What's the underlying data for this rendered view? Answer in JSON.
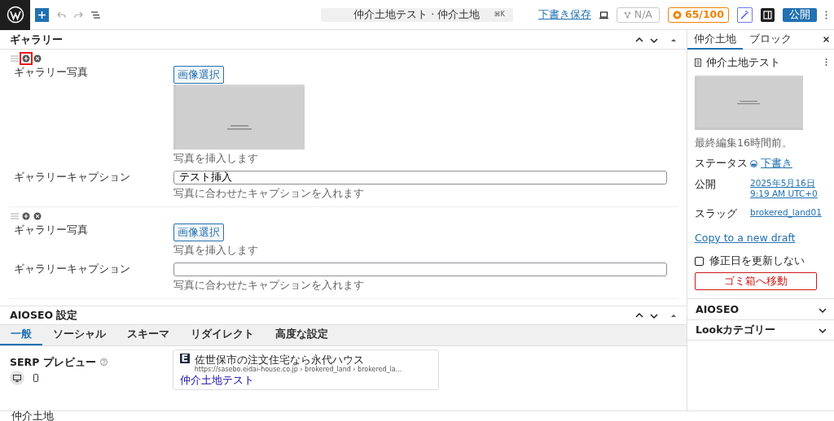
{
  "topbar": {
    "search": "仲介土地テスト · 仲介土地",
    "shortcut": "⌘K",
    "save_draft": "下書き保存",
    "seo_na": "N/A",
    "seo_score": "65/100",
    "publish": "公開"
  },
  "gallery": {
    "title": "ギャラリー",
    "items": [
      {
        "highlighted": true,
        "photo_label": "ギャラリー写真",
        "select_button": "画像選択",
        "has_image": true,
        "photo_help": "写真を挿入します",
        "caption_label": "ギャラリーキャプション",
        "caption_value": "テスト挿入",
        "caption_help": "写真に合わせたキャプションを入れます"
      },
      {
        "highlighted": false,
        "photo_label": "ギャラリー写真",
        "select_button": "画像選択",
        "has_image": false,
        "photo_help": "写真を挿入します",
        "caption_label": "ギャラリーキャプション",
        "caption_help": "写真に合わせたキャプションを入れます"
      }
    ]
  },
  "aioseo": {
    "title": "AIOSEO 設定",
    "tabs": [
      {
        "label": "一般",
        "selected": true
      },
      {
        "label": "ソーシャル",
        "selected": false
      },
      {
        "label": "スキーマ",
        "selected": false
      },
      {
        "label": "リダイレクト",
        "selected": false
      },
      {
        "label": "高度な設定",
        "selected": false
      }
    ],
    "serp_label": "SERP プレビュー",
    "devices": [
      {
        "kind": "desktop",
        "selected": true
      },
      {
        "kind": "mobile",
        "selected": false
      }
    ],
    "serp": {
      "favicon": "E",
      "site": "佐世保市の注文住宅なら永代ハウス",
      "url": "https://sasebo.eidai-house.co.jp › brokered_land › brokered_la...",
      "title": "仲介土地テスト"
    }
  },
  "sidebar": {
    "tabs": [
      {
        "label": "仲介土地",
        "selected": true
      },
      {
        "label": "ブロック",
        "selected": false
      }
    ],
    "post_title": "仲介土地テスト",
    "last_edited": "最終編集16時間前。",
    "fields": [
      {
        "kind": "status",
        "label": "ステータス",
        "lines": [
          "下書き"
        ]
      },
      {
        "kind": "link",
        "label": "公開",
        "lines": [
          "2025年5月16日",
          "9:19 AM UTC+0"
        ]
      },
      {
        "kind": "link",
        "label": "スラッグ",
        "lines": [
          "brokered_land01"
        ]
      }
    ],
    "copy_link": "Copy to a new draft",
    "no_update": {
      "label": "修正日を更新しない",
      "checked": false
    },
    "trash": "ゴミ箱へ移動",
    "panels": [
      {
        "title": "AIOSEO",
        "expanded": false
      },
      {
        "title": "Lookカテゴリー",
        "expanded": false
      }
    ]
  },
  "footer": {
    "breadcrumb": "仲介土地"
  }
}
